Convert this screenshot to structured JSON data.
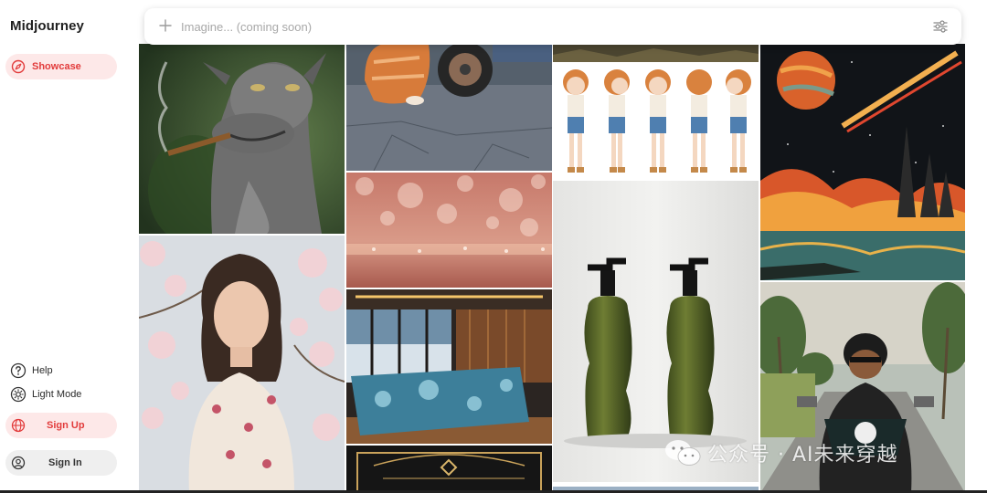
{
  "app": {
    "title": "Midjourney"
  },
  "sidebar": {
    "showcase_label": "Showcase",
    "help_label": "Help",
    "light_mode_label": "Light Mode",
    "sign_up_label": "Sign Up",
    "sign_in_label": "Sign In"
  },
  "search": {
    "placeholder": "Imagine... (coming soon)",
    "value": ""
  },
  "colors": {
    "accent": "#e23b3b",
    "accent_soft": "#fde8e8"
  },
  "gallery": {
    "images": [
      "goat-smoking",
      "orange-cat-by-car",
      "landscape-strip",
      "character-turnaround-sheet",
      "retro-space-planet",
      "rose-gold-glitter-bokeh",
      "woman-in-cherry-blossoms",
      "luxury-bar-interior",
      "olive-green-pump-bottles",
      "man-on-scooter",
      "gold-tarot-card",
      "partial-image"
    ]
  },
  "watermark": {
    "text": "公众号 · AI未来穿越"
  }
}
